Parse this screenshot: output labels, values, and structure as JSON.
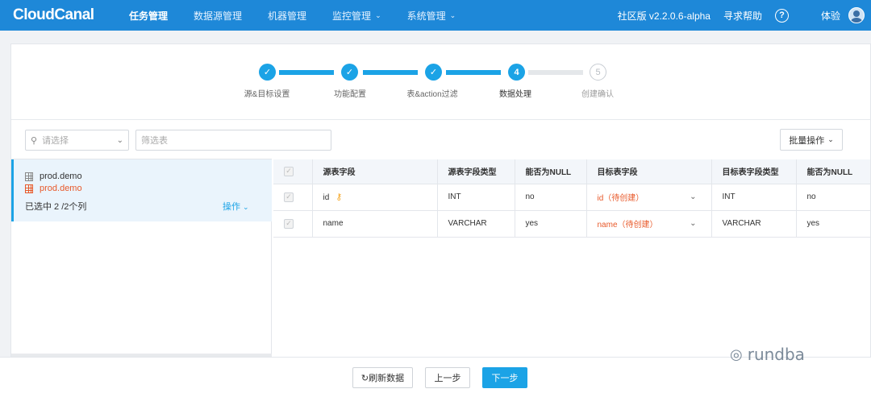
{
  "app": {
    "logo": "CloudCanal",
    "edition": "社区版 v2.2.0.6-alpha",
    "help": "寻求帮助",
    "user": "体验"
  },
  "nav": [
    {
      "label": "任务管理"
    },
    {
      "label": "数据源管理"
    },
    {
      "label": "机器管理"
    },
    {
      "label": "监控管理"
    },
    {
      "label": "系统管理"
    }
  ],
  "steps": [
    {
      "label": "源&目标设置",
      "mark": "✓"
    },
    {
      "label": "功能配置",
      "mark": "✓"
    },
    {
      "label": "表&action过滤",
      "mark": "✓"
    },
    {
      "label": "数据处理",
      "mark": "4"
    },
    {
      "label": "创建确认",
      "mark": "5"
    }
  ],
  "filters": {
    "select_placeholder": "请选择",
    "table_filter_placeholder": "筛选表",
    "batch_label": "批量操作"
  },
  "tree": {
    "source": "prod.demo",
    "target": "prod.demo",
    "selected": "已选中 2 /2个列",
    "op_label": "操作"
  },
  "table": {
    "headers": [
      "源表字段",
      "源表字段类型",
      "能否为NULL",
      "目标表字段",
      "目标表字段类型",
      "能否为NULL"
    ],
    "rows": [
      {
        "src": "id",
        "src_type": "INT",
        "src_null": "no",
        "target": "id（待创建）",
        "tgt_type": "INT",
        "tgt_null": "no"
      },
      {
        "src": "name",
        "src_type": "VARCHAR",
        "src_null": "yes",
        "target": "name（待创建）",
        "tgt_type": "VARCHAR",
        "tgt_null": "yes"
      }
    ]
  },
  "footer": {
    "refresh": "刷新数据",
    "prev": "上一步",
    "next": "下一步"
  },
  "watermark": "rundba",
  "colors": {
    "primary": "#1ba3e6",
    "topbar": "#1e88d8",
    "warn": "#e8592a"
  }
}
